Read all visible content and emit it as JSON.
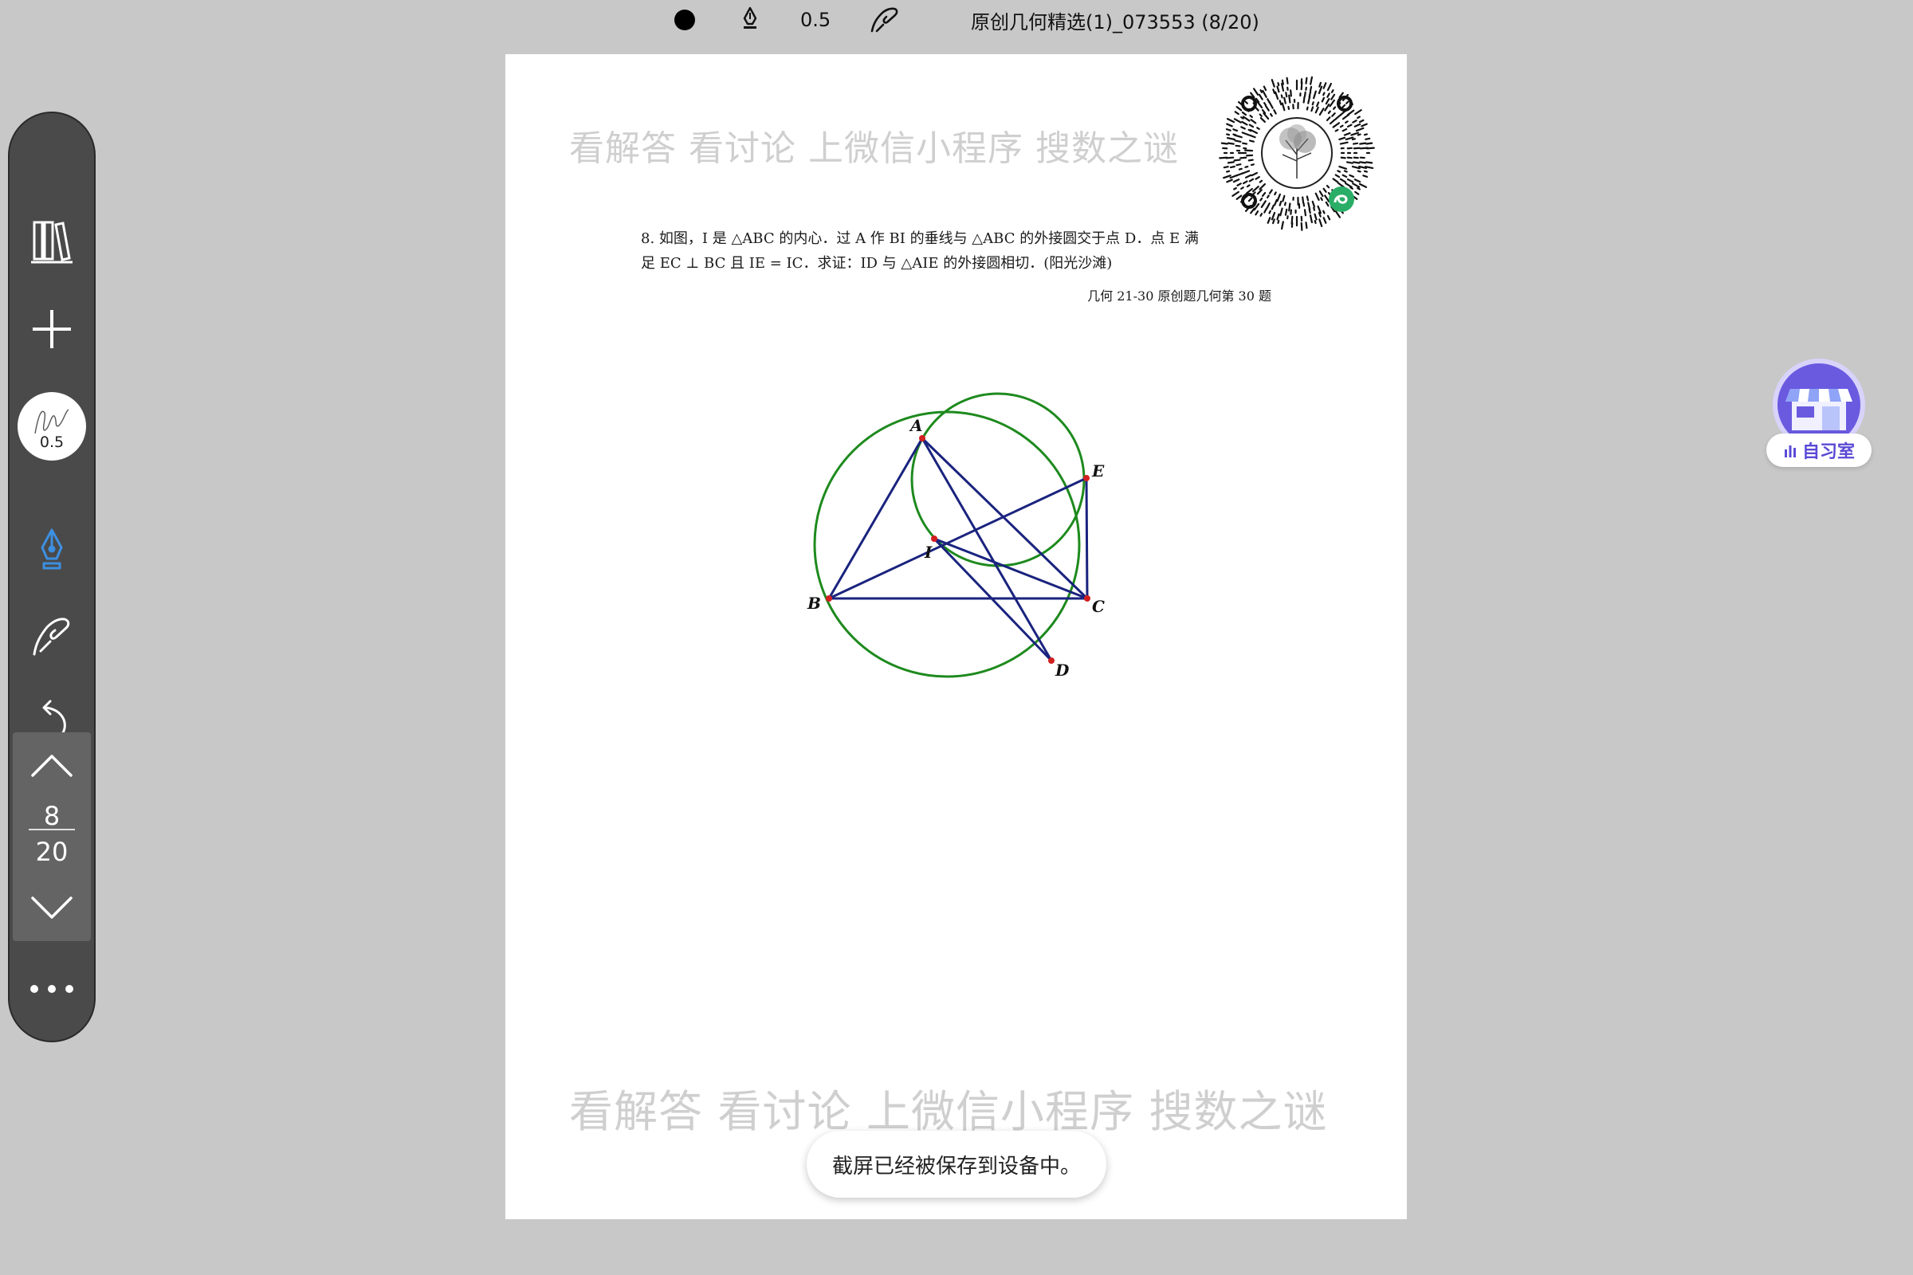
{
  "status_bar": {
    "ink_color": "#000000",
    "pen_tool_icon": "fountain-pen-icon",
    "stroke_width": "0.5",
    "eraser_icon": "gesture-hand-icon",
    "document_title": "原创几何精选(1)_073553 (8/20)"
  },
  "toolbar": {
    "items": [
      "library-icon",
      "add-icon",
      "reading-glasses-icon",
      "pen-size",
      "pen-icon",
      "hand-draw-icon",
      "undo-icon"
    ],
    "pen_size": "0.5",
    "active_tool": "pen",
    "accent_color": "#3d8fe0",
    "more_icon": "more-dots-icon"
  },
  "pager": {
    "current": "8",
    "total": "20"
  },
  "document": {
    "watermark_top": "看解答 看讨论 上微信小程序 搜数之谜",
    "watermark_bottom": "看解答 看讨论 上微信小程序 搜数之谜",
    "problem_line1": "8.  如图，I 是 △ABC 的内心．过 A 作 BI 的垂线与 △ABC 的外接圆交于点 D．点 E 满",
    "problem_line2": "足 EC ⊥ BC 且 IE = IC．求证：ID 与 △AIE 的外接圆相切．(阳光沙滩)",
    "source": "几何 21-30 原创题几何第 30 题",
    "figure_labels": {
      "A": "A",
      "B": "B",
      "C": "C",
      "D": "D",
      "E": "E",
      "I": "I"
    }
  },
  "toast": {
    "message": "截屏已经被保存到设备中。"
  },
  "study_room": {
    "label": "自习室",
    "icon": "study-room-store-icon"
  }
}
